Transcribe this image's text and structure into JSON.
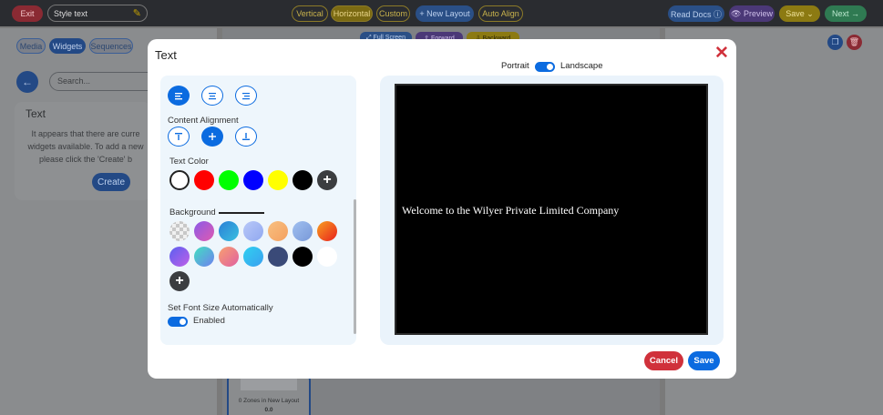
{
  "topbar": {
    "exit_label": "Exit",
    "style_input_value": "Style text",
    "layout_options": [
      "Vertical",
      "Horizontal",
      "Custom"
    ],
    "selected_layout": "Horizontal",
    "new_layout_label": "+ New Layout",
    "auto_align_label": "Auto Align",
    "read_docs_label": "Read Docs ⓘ",
    "preview_label": "👁 Preview",
    "save_label": "Save ⌄",
    "next_label": "Next →"
  },
  "left_panel": {
    "tabs": [
      "Media",
      "Widgets",
      "Sequences"
    ],
    "active_tab": "Widgets",
    "search_placeholder": "Search...",
    "card_title": "Text",
    "card_body": "It appears that there are curre widgets available. To add a new please click the 'Create' b",
    "create_label": "Create"
  },
  "center": {
    "fullscreen_label": "⤢ Full Screen",
    "forward_label": "⇧ Forward",
    "backward_label": "⇩ Backward",
    "zones_label": "0 Zones in New Layout",
    "zones_value": "0.0"
  },
  "modal": {
    "title": "Text",
    "content_alignment_label": "Content Alignment",
    "text_color_label": "Text Color",
    "text_colors": [
      "#ffffff",
      "#ff0000",
      "#00ff00",
      "#0000ff",
      "#ffff00",
      "#000000"
    ],
    "selected_text_color": "#ffffff",
    "background_label": "Background",
    "background_swatches_row1": [
      "checkerboard",
      "#b05ad8",
      "#2a9fd6",
      "#a4b8f5",
      "#f7b774",
      "#8fb2e6",
      "#f04a1e"
    ],
    "background_swatches_row2": [
      "#7b61f0",
      "#3ad3d0",
      "#f07878",
      "#36c4f0",
      "#3a4a78",
      "#000000",
      "#ffffff"
    ],
    "font_size_label": "Set Font Size Automatically",
    "font_size_state": "Enabled",
    "orientation_portrait": "Portrait",
    "orientation_landscape": "Landscape",
    "orientation_value": "Landscape",
    "preview_text": "Welcome to the Wilyer Private Limited Company",
    "cancel_label": "Cancel",
    "save_label": "Save"
  },
  "colors": {
    "accent": "#0b6be0",
    "danger": "#d0313b"
  }
}
